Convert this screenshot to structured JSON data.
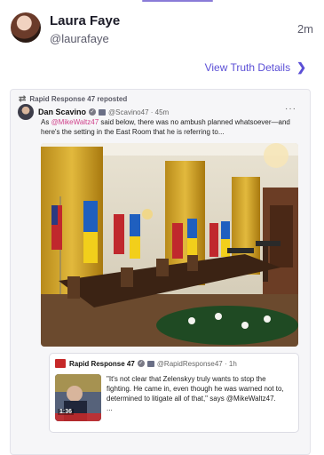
{
  "author": {
    "display_name": "Laura Faye",
    "handle": "@laurafaye",
    "time": "2m"
  },
  "details_link": {
    "label": "View Truth Details",
    "chevron": "❯"
  },
  "repost": {
    "label": "Rapid Response 47 reposted",
    "icon": "repost-icon"
  },
  "inner_post": {
    "name": "Dan Scavino",
    "handle": "@Scavino47 · 45m",
    "text_prefix": "As ",
    "mention": "@MikeWaltz47",
    "text_suffix": " said below, there was no ambush planned whatsoever—and here's the setting in the East Room that he is referring to...",
    "more": "···"
  },
  "quoted_post": {
    "name": "Rapid Response 47",
    "handle": "@RapidResponse47 · 1h",
    "text": "\"It's not clear that Zelenskyy truly wants to stop the fighting. He came in, even though he was warned not to, determined to litigate all of that,\" says @MikeWaltz47.",
    "ellipsis": "...",
    "video_duration": "1:36"
  },
  "colors": {
    "accent": "#5b4fd6",
    "mention": "#d0408a",
    "card_bg": "#f6f6f8"
  }
}
